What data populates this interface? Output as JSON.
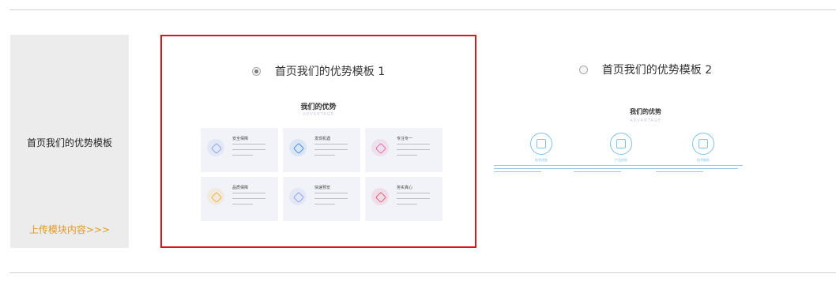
{
  "side": {
    "title": "首页我们的优势模板",
    "upload": "上传模块内容>>>"
  },
  "templates": [
    {
      "label": "首页我们的优势模板 1",
      "selected": true,
      "preview": {
        "title": "我们的优势",
        "subtitle": "ADVANTAGE",
        "tiles": [
          {
            "name": "安全保障",
            "icon": "shield-icon",
            "color": "#8ea3e8"
          },
          {
            "name": "发现机遇",
            "icon": "compress-icon",
            "color": "#4a90e2"
          },
          {
            "name": "专注专一",
            "icon": "target-icon",
            "color": "#e86aa6"
          },
          {
            "name": "品质保障",
            "icon": "diamond-icon",
            "color": "#f0b23d"
          },
          {
            "name": "快速预览",
            "icon": "shield-check-icon",
            "color": "#8ea3e8"
          },
          {
            "name": "务实真心",
            "icon": "heart-icon",
            "color": "#e85a7a"
          }
        ]
      }
    },
    {
      "label": "首页我们的优势模板 2",
      "selected": false,
      "preview": {
        "title": "我们的优势",
        "subtitle": "ADVANTAGE",
        "features": [
          {
            "name": "技术优势",
            "icon": "globe-icon"
          },
          {
            "name": "产品优势",
            "icon": "devices-icon"
          },
          {
            "name": "技术服务",
            "icon": "qr-icon"
          }
        ]
      }
    }
  ]
}
